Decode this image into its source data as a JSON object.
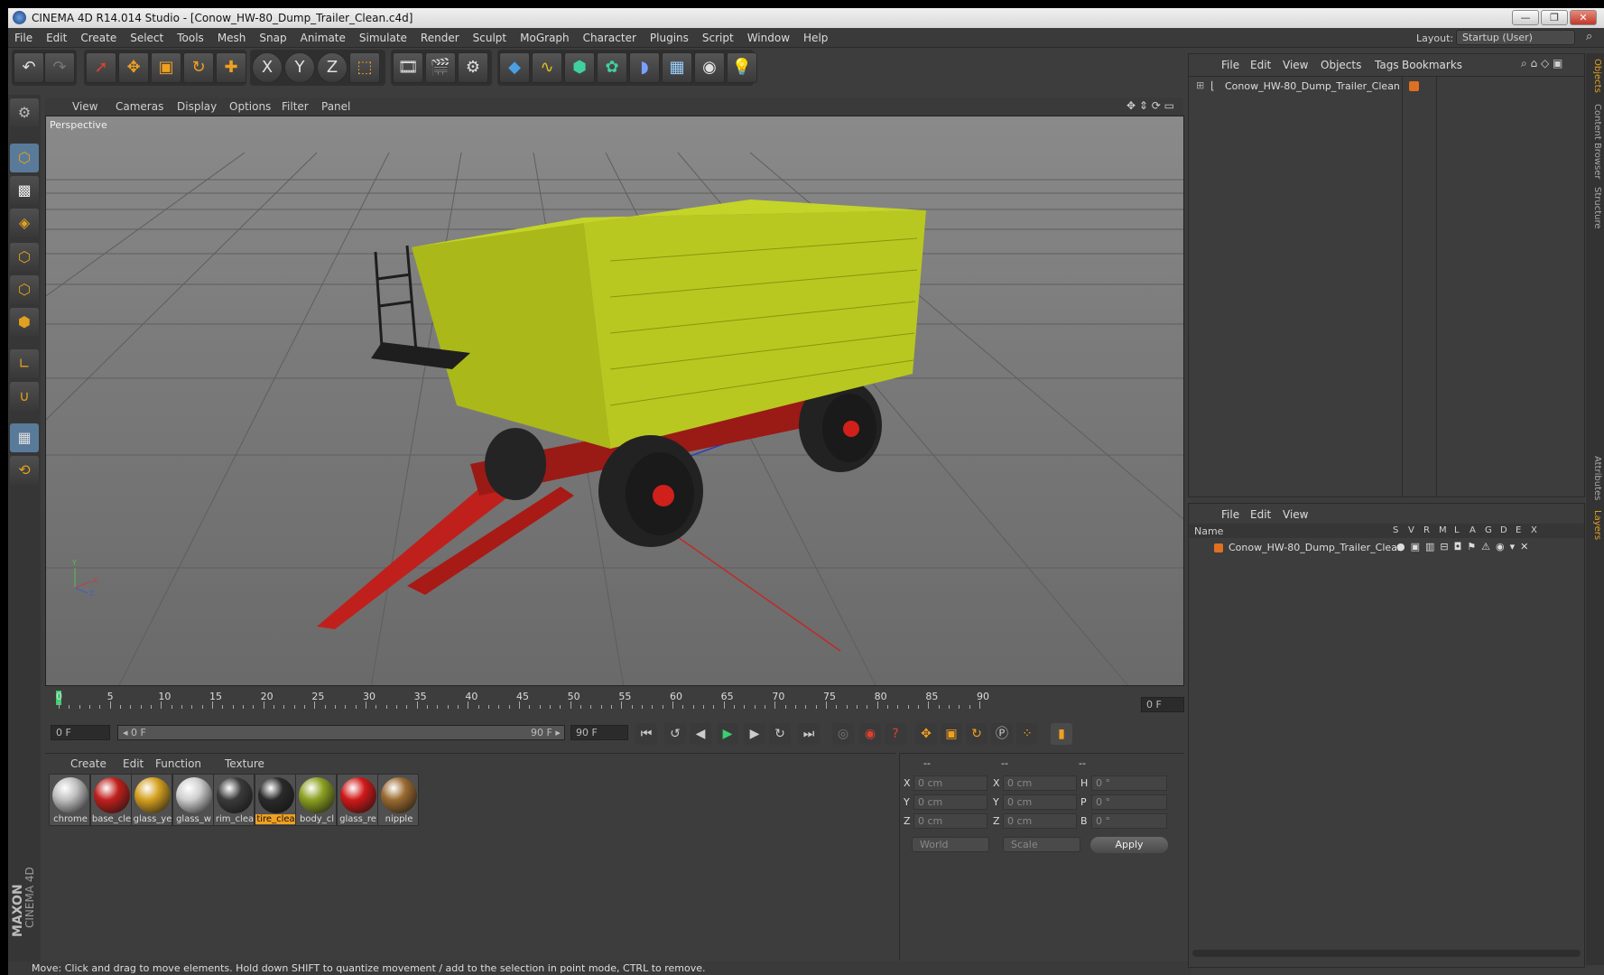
{
  "window": {
    "title": "CINEMA 4D R14.014 Studio - [Conow_HW-80_Dump_Trailer_Clean.c4d]",
    "min": "—",
    "restore": "❐",
    "close": "✕"
  },
  "menubar": {
    "items": [
      "File",
      "Edit",
      "Create",
      "Select",
      "Tools",
      "Mesh",
      "Snap",
      "Animate",
      "Simulate",
      "Render",
      "Sculpt",
      "MoGraph",
      "Character",
      "Plugins",
      "Script",
      "Window",
      "Help"
    ],
    "layout_label": "Layout:",
    "layout_value": "Startup (User)"
  },
  "toolbar": {
    "icons": [
      "undo-icon",
      "redo-icon",
      "select-icon",
      "move-icon",
      "scale-icon",
      "rotate-icon",
      "add-icon",
      "x-axis-icon",
      "y-axis-icon",
      "z-axis-icon",
      "coord-system-icon",
      "render-view-icon",
      "render-picture-icon",
      "render-settings-icon",
      "cube-icon",
      "spline-icon",
      "nurbs-icon",
      "array-icon",
      "deformer-icon",
      "floor-icon",
      "camera-icon",
      "light-icon"
    ],
    "axis_x": "X",
    "axis_y": "Y",
    "axis_z": "Z"
  },
  "viewport": {
    "menu": [
      "View",
      "Cameras",
      "Display",
      "Options",
      "Filter",
      "Panel"
    ],
    "label": "Perspective",
    "axis_y": "Y",
    "axis_x": "X",
    "axis_z": "Z"
  },
  "timeline": {
    "ticks": [
      "0",
      "5",
      "10",
      "15",
      "20",
      "25",
      "30",
      "35",
      "40",
      "45",
      "50",
      "55",
      "60",
      "65",
      "70",
      "75",
      "80",
      "85",
      "90"
    ],
    "end_frame_field": "0 F",
    "current_frame": "0 F",
    "range_start": "◂ 0 F",
    "range_end": "90 F ▸",
    "end_field": "90 F"
  },
  "materials": {
    "menu": [
      "Create",
      "Edit",
      "Function",
      "Texture"
    ],
    "items": [
      {
        "label": "chrome",
        "color": "#bfbfbf"
      },
      {
        "label": "base_cle",
        "color": "#c0201c"
      },
      {
        "label": "glass_ye",
        "color": "#d4a020"
      },
      {
        "label": "glass_w",
        "color": "#cfcfcf"
      },
      {
        "label": "rim_clea",
        "color": "#3a3a3a"
      },
      {
        "label": "tire_clea",
        "color": "#2a2a2a"
      },
      {
        "label": "body_cl",
        "color": "#8aa020"
      },
      {
        "label": "glass_re",
        "color": "#d01818"
      },
      {
        "label": "nipple",
        "color": "#9a6a30"
      }
    ],
    "selected": "tire_clea"
  },
  "coordinates": {
    "headers": [
      "--",
      "--",
      "--"
    ],
    "rows": [
      {
        "a": "X",
        "av": "0 cm",
        "b": "X",
        "bv": "0 cm",
        "c": "H",
        "cv": "0 °"
      },
      {
        "a": "Y",
        "av": "0 cm",
        "b": "Y",
        "bv": "0 cm",
        "c": "P",
        "cv": "0 °"
      },
      {
        "a": "Z",
        "av": "0 cm",
        "b": "Z",
        "bv": "0 cm",
        "c": "B",
        "cv": "0 °"
      }
    ],
    "world": "World",
    "scale": "Scale",
    "apply": "Apply"
  },
  "object_manager": {
    "menu": [
      "File",
      "Edit",
      "View",
      "Objects",
      "Tags",
      "Bookmarks"
    ],
    "object": "Conow_HW-80_Dump_Trailer_Clean"
  },
  "layer_manager": {
    "menu": [
      "File",
      "Edit",
      "View"
    ],
    "name_header": "Name",
    "columns": [
      "S",
      "V",
      "R",
      "M",
      "L",
      "A",
      "G",
      "D",
      "E",
      "X"
    ],
    "layer": "Conow_HW-80_Dump_Trailer_Clean"
  },
  "right_tabs": [
    "Objects",
    "Content Browser",
    "Structure",
    "Attributes",
    "Layers"
  ],
  "status": "Move: Click and drag to move elements. Hold down SHIFT to quantize movement / add to the selection in point mode, CTRL to remove.",
  "brand": {
    "line1": "MAXON",
    "line2": "CINEMA 4D"
  }
}
